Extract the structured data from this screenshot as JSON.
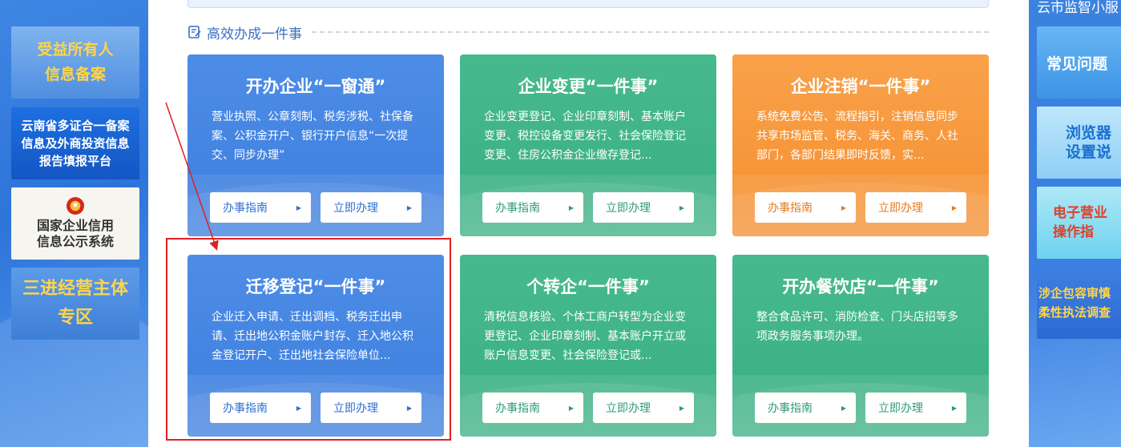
{
  "left_banners": [
    {
      "lines": [
        "受益所有人",
        "信息备案"
      ]
    },
    {
      "lines": [
        "云南省多证合一备案",
        "信息及外商投资信息",
        "报告填报平台"
      ]
    },
    {
      "lines": [
        "国家企业信用",
        "信息公示系统"
      ]
    },
    {
      "lines": [
        "三进经营主体",
        "专区"
      ]
    }
  ],
  "right_sidebar": {
    "title": "云市监智小服",
    "banners": [
      {
        "lines": [
          "常见问题"
        ]
      },
      {
        "lines": [
          "浏览器",
          "设置说"
        ]
      },
      {
        "lines": [
          "电子营业",
          "操作指"
        ]
      },
      {
        "lines": [
          "涉企包容审慎",
          "柔性执法调查"
        ]
      }
    ]
  },
  "section": {
    "title": "高效办成一件事"
  },
  "cards": [
    {
      "title": "开办企业“一窗通”",
      "desc": "营业执照、公章刻制、税务涉税、社保备案、公积金开户、银行开户信息“一次提交、同步办理”",
      "guide": "办事指南",
      "apply": "立即办理",
      "color": "blue"
    },
    {
      "title": "企业变更“一件事”",
      "desc": "企业变更登记、企业印章刻制、基本账户变更、税控设备变更发行、社会保险登记变更、住房公积金企业缴存登记...",
      "guide": "办事指南",
      "apply": "立即办理",
      "color": "green"
    },
    {
      "title": "企业注销“一件事”",
      "desc": "系统免费公告、流程指引，注销信息同步共享市场监管、税务、海关、商务、人社部门，各部门结果即时反馈，实...",
      "guide": "办事指南",
      "apply": "立即办理",
      "color": "orange"
    },
    {
      "title": "迁移登记“一件事”",
      "desc": "企业迁入申请、迁出调档、税务迁出申请、迁出地公积金账户封存、迁入地公积金登记开户、迁出地社会保险单位...",
      "guide": "办事指南",
      "apply": "立即办理",
      "color": "blue"
    },
    {
      "title": "个转企“一件事”",
      "desc": "清税信息核验、个体工商户转型为企业变更登记、企业印章刻制、基本账户开立或账户信息变更、社会保险登记或...",
      "guide": "办事指南",
      "apply": "立即办理",
      "color": "green"
    },
    {
      "title": "开办餐饮店“一件事”",
      "desc": "整合食品许可、消防检查、门头店招等多项政务服务事项办理。",
      "guide": "办事指南",
      "apply": "立即办理",
      "color": "green"
    }
  ],
  "colors": {
    "blue": "#4d8de6",
    "green": "#47b98f",
    "orange": "#f9a24a",
    "annotation": "#e02020"
  }
}
